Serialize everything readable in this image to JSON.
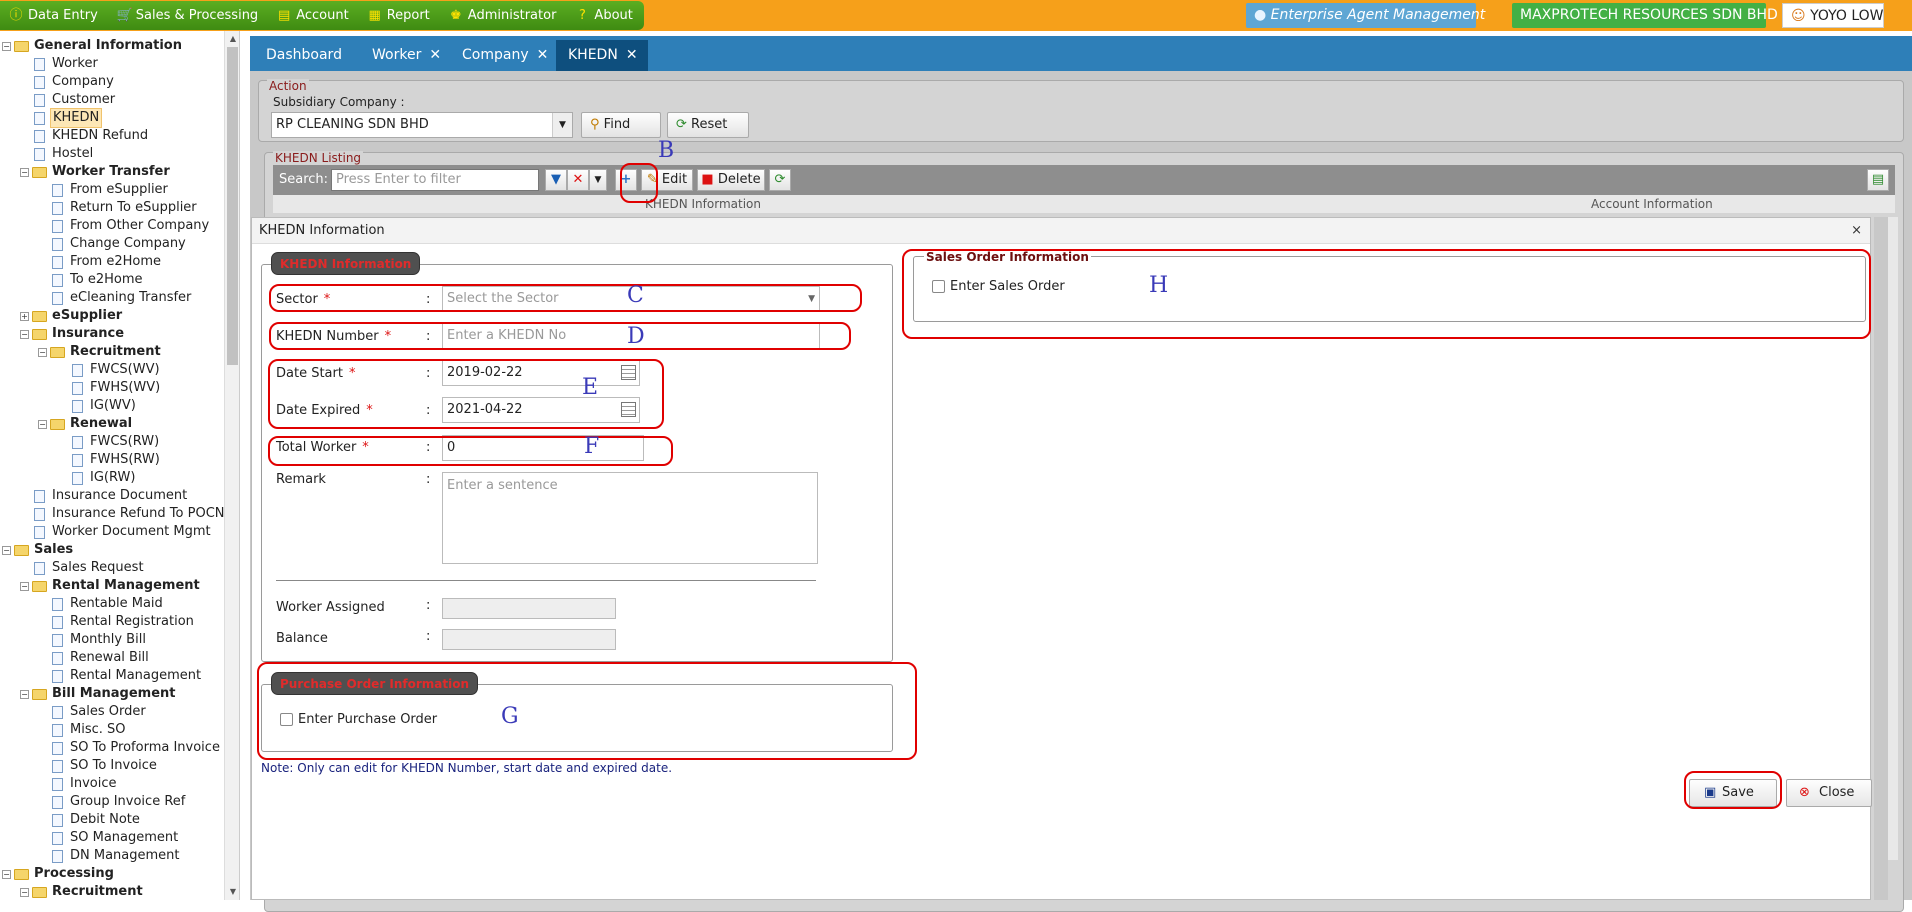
{
  "topmenu": {
    "items": [
      {
        "label": "Data Entry",
        "icon": "info-icon"
      },
      {
        "label": "Sales & Processing",
        "icon": "cart-icon"
      },
      {
        "label": "Account",
        "icon": "ledger-icon"
      },
      {
        "label": "Report",
        "icon": "table-icon"
      },
      {
        "label": "Administrator",
        "icon": "admin-icon"
      },
      {
        "label": "About",
        "icon": "help-icon"
      }
    ],
    "enterprise_label": "Enterprise Agent Management",
    "company_name": "MAXPROTECH RESOURCES SDN BHD",
    "user_name": "YOYO LOW"
  },
  "sidebar": {
    "general": "General Information",
    "worker": "Worker",
    "company": "Company",
    "customer": "Customer",
    "khedn": "KHEDN",
    "khedn_refund": "KHEDN Refund",
    "hostel": "Hostel",
    "worker_transfer": "Worker Transfer",
    "from_esupplier": "From eSupplier",
    "return_to_esupplier": "Return To eSupplier",
    "from_other_company": "From Other Company",
    "change_company": "Change Company",
    "from_e2home": "From e2Home",
    "to_e2home": "To e2Home",
    "ecleaning_transfer": "eCleaning Transfer",
    "esupplier": "eSupplier",
    "insurance": "Insurance",
    "recruitment": "Recruitment",
    "fwcs_wv": "FWCS(WV)",
    "fwhs_wv": "FWHS(WV)",
    "ig_wv": "IG(WV)",
    "renewal": "Renewal",
    "fwcs_rw": "FWCS(RW)",
    "fwhs_rw": "FWHS(RW)",
    "ig_rw": "IG(RW)",
    "insurance_document": "Insurance Document",
    "insurance_refund": "Insurance Refund To POCN",
    "worker_doc_mgmt": "Worker Document Mgmt",
    "sales": "Sales",
    "sales_request": "Sales Request",
    "rental_management": "Rental Management",
    "rentable_maid": "Rentable Maid",
    "rental_registration": "Rental Registration",
    "monthly_bill": "Monthly Bill",
    "renewal_bill": "Renewal Bill",
    "rental_management_item": "Rental Management",
    "bill_management": "Bill Management",
    "sales_order": "Sales Order",
    "misc_so": "Misc. SO",
    "so_to_proforma": "SO To Proforma Invoice",
    "so_to_invoice": "SO To Invoice",
    "invoice": "Invoice",
    "group_invoice_ref": "Group Invoice Ref",
    "debit_note": "Debit Note",
    "so_management": "SO Management",
    "dn_management": "DN Management",
    "processing": "Processing",
    "processing_recruitment": "Recruitment"
  },
  "tabs": [
    {
      "label": "Dashboard",
      "closable": false
    },
    {
      "label": "Worker",
      "closable": true
    },
    {
      "label": "Company",
      "closable": true
    },
    {
      "label": "KHEDN",
      "closable": true,
      "active": true
    }
  ],
  "tab_close_glyph": "✕",
  "action": {
    "legend": "Action",
    "subsidiary_label": "Subsidiary Company :",
    "subsidiary_value": "RP CLEANING SDN BHD",
    "find_label": "Find",
    "reset_label": "Reset"
  },
  "listing": {
    "legend": "KHEDN Listing",
    "search_label": "Search:",
    "search_placeholder": "Press Enter to filter",
    "edit_label": "Edit",
    "delete_label": "Delete",
    "col_khedn_info": "KHEDN Information",
    "col_account_info": "Account Information"
  },
  "dialog": {
    "title": "KHEDN Information",
    "close_glyph": "×",
    "khedn_legend": "KHEDN Information",
    "sector_label": "Sector",
    "sector_placeholder": "Select the Sector",
    "khedn_number_label": "KHEDN Number",
    "khedn_number_placeholder": "Enter a KHEDN No",
    "date_start_label": "Date Start",
    "date_start_value": "2019-02-22",
    "date_expired_label": "Date Expired",
    "date_expired_value": "2021-04-22",
    "total_worker_label": "Total Worker",
    "total_worker_value": "0",
    "remark_label": "Remark",
    "remark_placeholder": "Enter a sentence",
    "worker_assigned_label": "Worker Assigned",
    "balance_label": "Balance",
    "required_mark": "*",
    "colon": ":",
    "purchase_legend": "Purchase Order Information",
    "purchase_checkbox_label": "Enter Purchase Order",
    "sales_legend": "Sales Order Information",
    "sales_checkbox_label": "Enter Sales Order",
    "note": "Note: Only can edit for KHEDN Number, start date and expired date.",
    "save_label": "Save",
    "close_label": "Close"
  },
  "annotations": {
    "b": "B",
    "c": "C",
    "d": "D",
    "e": "E",
    "f": "F",
    "g": "G",
    "h": "H"
  },
  "colors": {
    "topbar": "#f6a01a",
    "menu_green": "#4a9a18",
    "tab_bar": "#2e7fb8",
    "active_tab": "#0e4f7e",
    "annotation_red": "#e00000",
    "annotation_letter": "#3a3ab8"
  }
}
